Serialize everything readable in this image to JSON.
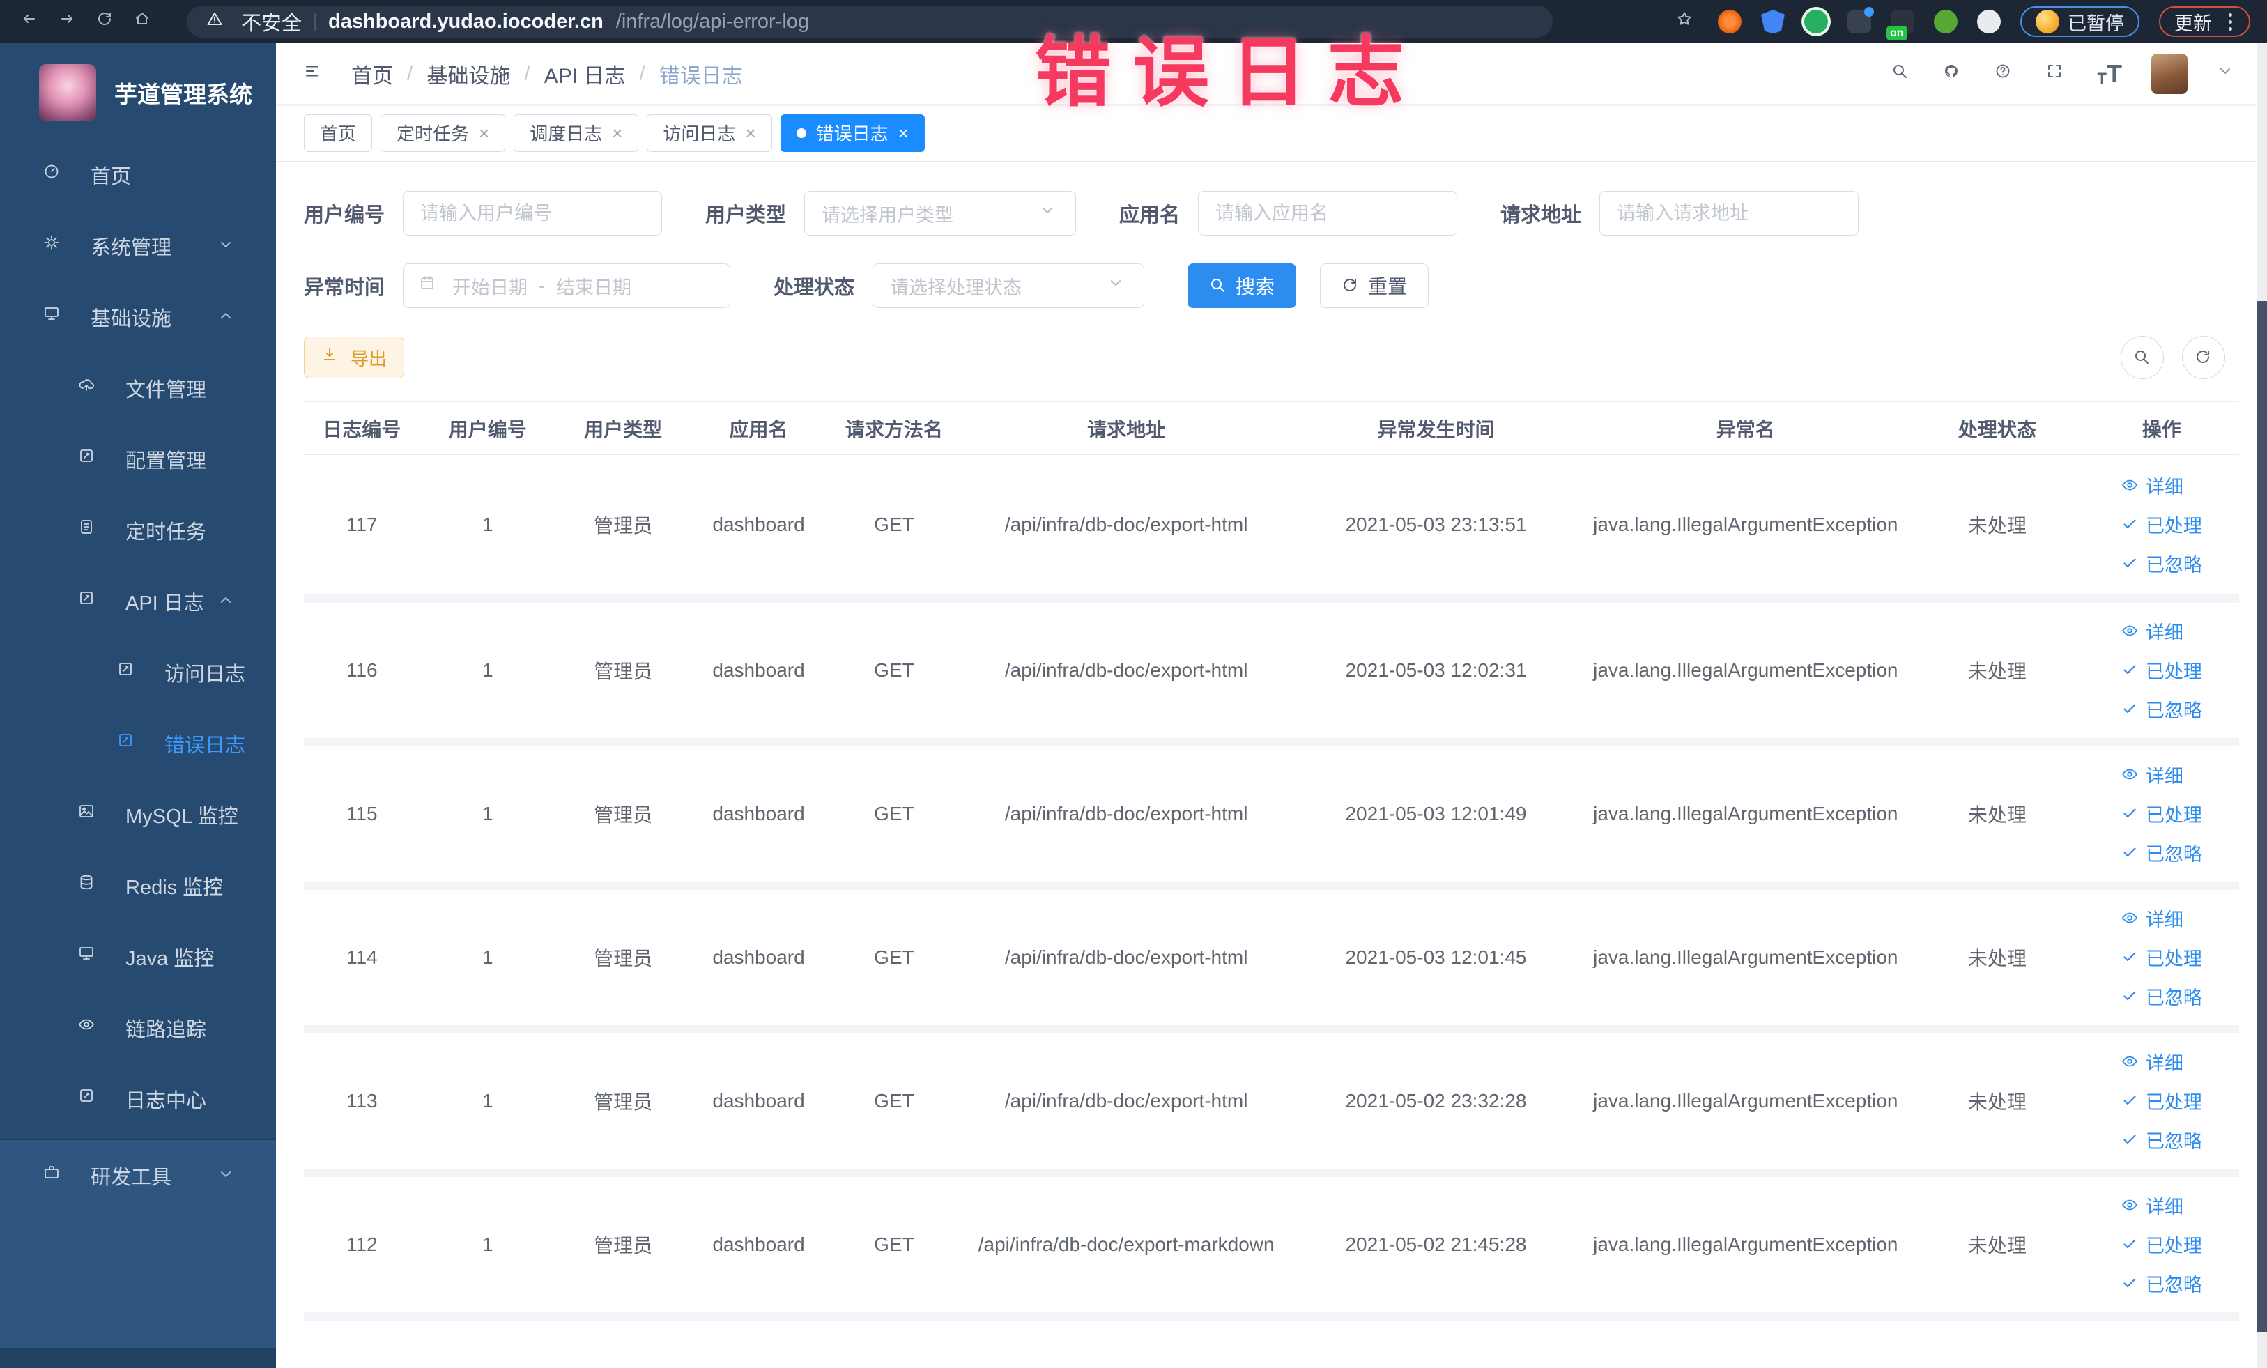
{
  "colors": {
    "primary": "#2d8cf0",
    "active_tab": "#1a8cff",
    "sidebar_bg": "#274a70",
    "warning_text": "#df9b2a",
    "annotation_pink": "#f5395f",
    "link_blue": "#2d8cf0"
  },
  "browser": {
    "security_label": "不安全",
    "url_domain": "dashboard.yudao.iocoder.cn",
    "url_path": "/infra/log/api-error-log",
    "extension_badge": "on",
    "paused_label": "已暂停",
    "update_label": "更新"
  },
  "annotation": {
    "text": "错误日志"
  },
  "sidebar": {
    "title": "芋道管理系统",
    "items": [
      {
        "label": "首页"
      },
      {
        "label": "系统管理"
      },
      {
        "label": "基础设施"
      },
      {
        "label": "文件管理"
      },
      {
        "label": "配置管理"
      },
      {
        "label": "定时任务"
      },
      {
        "label": "API 日志"
      },
      {
        "label": "访问日志"
      },
      {
        "label": "错误日志"
      },
      {
        "label": "MySQL 监控"
      },
      {
        "label": "Redis 监控"
      },
      {
        "label": "Java 监控"
      },
      {
        "label": "链路追踪"
      },
      {
        "label": "日志中心"
      },
      {
        "label": "研发工具"
      }
    ]
  },
  "header": {
    "breadcrumb": [
      "首页",
      "基础设施",
      "API 日志",
      "错误日志"
    ],
    "separator": "/"
  },
  "tabs": [
    {
      "label": "首页"
    },
    {
      "label": "定时任务"
    },
    {
      "label": "调度日志"
    },
    {
      "label": "访问日志"
    },
    {
      "label": "错误日志"
    }
  ],
  "icons": {
    "close": "×",
    "font_large": "T",
    "font_small": "T"
  },
  "filters": {
    "user_id_label": "用户编号",
    "user_id_placeholder": "请输入用户编号",
    "user_type_label": "用户类型",
    "user_type_placeholder": "请选择用户类型",
    "app_name_label": "应用名",
    "app_name_placeholder": "请输入应用名",
    "request_url_label": "请求地址",
    "request_url_placeholder": "请输入请求地址",
    "time_label": "异常时间",
    "time_start_placeholder": "开始日期",
    "time_separator": "-",
    "time_end_placeholder": "结束日期",
    "status_label": "处理状态",
    "status_placeholder": "请选择处理状态",
    "search_label": "搜索",
    "reset_label": "重置"
  },
  "toolbar": {
    "export_label": "导出"
  },
  "table": {
    "headers": [
      "日志编号",
      "用户编号",
      "用户类型",
      "应用名",
      "请求方法名",
      "请求地址",
      "异常发生时间",
      "异常名",
      "处理状态",
      "操作"
    ],
    "action_labels": {
      "detail": "详细",
      "processed": "已处理",
      "ignored": "已忽略"
    },
    "rows": [
      {
        "id": "117",
        "user_id": "1",
        "user_type": "管理员",
        "app_name": "dashboard",
        "method": "GET",
        "url": "/api/infra/db-doc/export-html",
        "time": "2021-05-03 23:13:51",
        "exception": "java.lang.IllegalArgumentException",
        "status": "未处理"
      },
      {
        "id": "116",
        "user_id": "1",
        "user_type": "管理员",
        "app_name": "dashboard",
        "method": "GET",
        "url": "/api/infra/db-doc/export-html",
        "time": "2021-05-03 12:02:31",
        "exception": "java.lang.IllegalArgumentException",
        "status": "未处理"
      },
      {
        "id": "115",
        "user_id": "1",
        "user_type": "管理员",
        "app_name": "dashboard",
        "method": "GET",
        "url": "/api/infra/db-doc/export-html",
        "time": "2021-05-03 12:01:49",
        "exception": "java.lang.IllegalArgumentException",
        "status": "未处理"
      },
      {
        "id": "114",
        "user_id": "1",
        "user_type": "管理员",
        "app_name": "dashboard",
        "method": "GET",
        "url": "/api/infra/db-doc/export-html",
        "time": "2021-05-03 12:01:45",
        "exception": "java.lang.IllegalArgumentException",
        "status": "未处理"
      },
      {
        "id": "113",
        "user_id": "1",
        "user_type": "管理员",
        "app_name": "dashboard",
        "method": "GET",
        "url": "/api/infra/db-doc/export-html",
        "time": "2021-05-02 23:32:28",
        "exception": "java.lang.IllegalArgumentException",
        "status": "未处理"
      },
      {
        "id": "112",
        "user_id": "1",
        "user_type": "管理员",
        "app_name": "dashboard",
        "method": "GET",
        "url": "/api/infra/db-doc/export-markdown",
        "time": "2021-05-02 21:45:28",
        "exception": "java.lang.IllegalArgumentException",
        "status": "未处理"
      }
    ]
  }
}
